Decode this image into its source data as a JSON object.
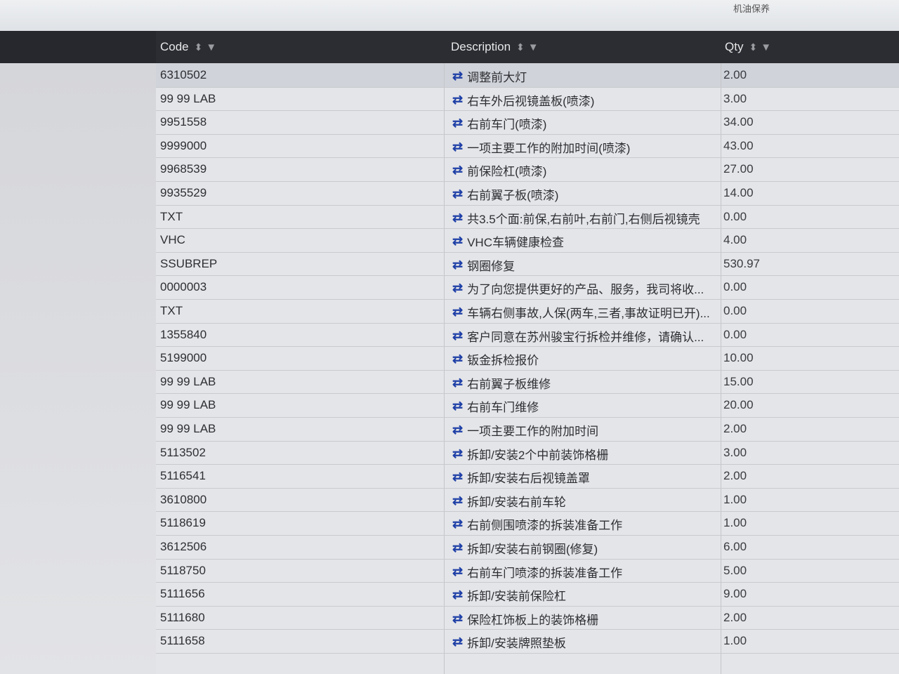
{
  "top_label": "机油保养",
  "columns": {
    "code": "Code",
    "description": "Description",
    "qty": "Qty"
  },
  "rows": [
    {
      "code": "6310502",
      "description": "调整前大灯",
      "qty": "2.00"
    },
    {
      "code": "99 99 LAB",
      "description": "右车外后视镜盖板(喷漆)",
      "qty": "3.00"
    },
    {
      "code": "9951558",
      "description": "右前车门(喷漆)",
      "qty": "34.00"
    },
    {
      "code": "9999000",
      "description": "一项主要工作的附加时间(喷漆)",
      "qty": "43.00"
    },
    {
      "code": "9968539",
      "description": "前保险杠(喷漆)",
      "qty": "27.00"
    },
    {
      "code": "9935529",
      "description": "右前翼子板(喷漆)",
      "qty": "14.00"
    },
    {
      "code": "TXT",
      "description": "共3.5个面:前保,右前叶,右前门,右侧后视镜壳",
      "qty": "0.00"
    },
    {
      "code": "VHC",
      "description": "VHC车辆健康检查",
      "qty": "4.00"
    },
    {
      "code": "SSUBREP",
      "description": "钢圈修复",
      "qty": "530.97"
    },
    {
      "code": "0000003",
      "description": "为了向您提供更好的产品、服务，我司将收...",
      "qty": "0.00"
    },
    {
      "code": "TXT",
      "description": "车辆右侧事故,人保(两车,三者,事故证明已开)...",
      "qty": "0.00"
    },
    {
      "code": "1355840",
      "description": "客户同意在苏州骏宝行拆检并维修，请确认...",
      "qty": "0.00"
    },
    {
      "code": "5199000",
      "description": "钣金拆检报价",
      "qty": "10.00"
    },
    {
      "code": "99 99 LAB",
      "description": "右前翼子板维修",
      "qty": "15.00"
    },
    {
      "code": "99 99 LAB",
      "description": "右前车门维修",
      "qty": "20.00"
    },
    {
      "code": "99 99 LAB",
      "description": "一项主要工作的附加时间",
      "qty": "2.00"
    },
    {
      "code": "5113502",
      "description": "拆卸/安装2个中前装饰格栅",
      "qty": "3.00"
    },
    {
      "code": "5116541",
      "description": "拆卸/安装右后视镜盖罩",
      "qty": "2.00"
    },
    {
      "code": "3610800",
      "description": "拆卸/安装右前车轮",
      "qty": "1.00"
    },
    {
      "code": "5118619",
      "description": "右前侧围喷漆的拆装准备工作",
      "qty": "1.00"
    },
    {
      "code": "3612506",
      "description": "拆卸/安装右前钢圈(修复)",
      "qty": "6.00"
    },
    {
      "code": "5118750",
      "description": "右前车门喷漆的拆装准备工作",
      "qty": "5.00"
    },
    {
      "code": "5111656",
      "description": "拆卸/安装前保险杠",
      "qty": "9.00"
    },
    {
      "code": "5111680",
      "description": "保险杠饰板上的装饰格栅",
      "qty": "2.00"
    },
    {
      "code": "5111658",
      "description": "拆卸/安装牌照垫板",
      "qty": "1.00"
    }
  ]
}
